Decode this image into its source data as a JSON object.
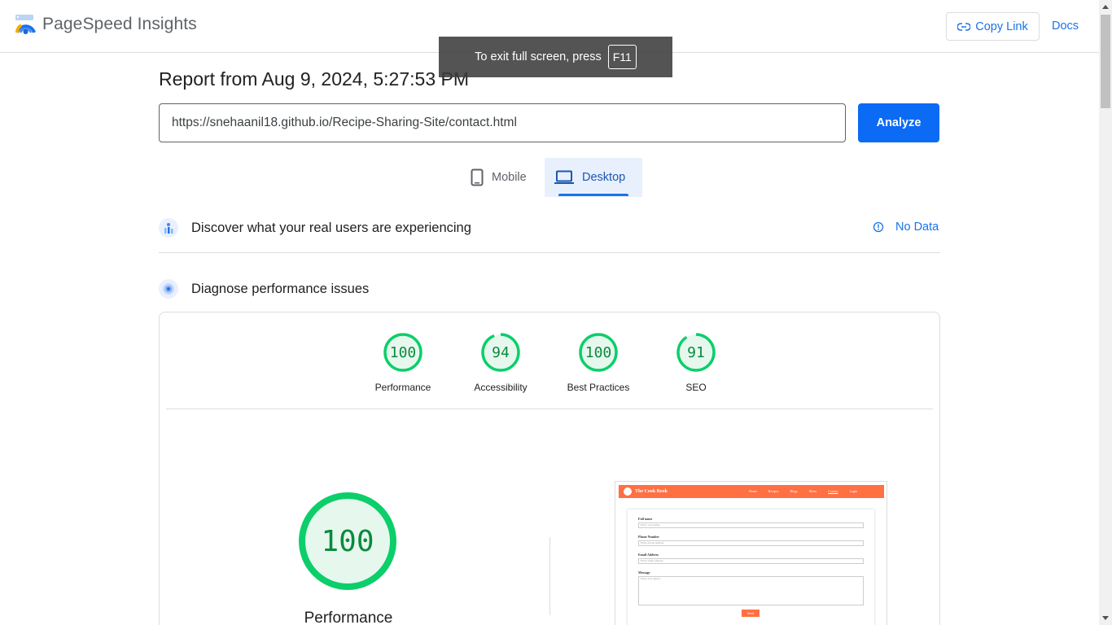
{
  "header": {
    "brand": "PageSpeed Insights",
    "copy_link": "Copy Link",
    "docs": "Docs"
  },
  "toast": {
    "text": "To exit full screen, press",
    "key": "F11"
  },
  "report": {
    "title": "Report from Aug 9, 2024, 5:27:53 PM",
    "url": "https://snehaanil18.github.io/Recipe-Sharing-Site/contact.html",
    "analyze_label": "Analyze"
  },
  "tabs": {
    "mobile": "Mobile",
    "desktop": "Desktop",
    "selected": "Desktop"
  },
  "sections": {
    "real_users": "Discover what your real users are experiencing",
    "no_data": "No Data",
    "diagnose": "Diagnose performance issues"
  },
  "scores": [
    {
      "label": "Performance",
      "value": "100",
      "fraction": 1.0
    },
    {
      "label": "Accessibility",
      "value": "94",
      "fraction": 0.94
    },
    {
      "label": "Best Practices",
      "value": "100",
      "fraction": 1.0
    },
    {
      "label": "SEO",
      "value": "91",
      "fraction": 0.91
    }
  ],
  "main_score": {
    "value": "100",
    "label": "Performance",
    "fraction": 1.0
  },
  "thumbnail": {
    "site_name": "The Cook Book",
    "nav": [
      "Home",
      "Recipes",
      "Blogs",
      "Menu",
      "Contact",
      "Login"
    ],
    "fields": [
      {
        "label": "Full name",
        "placeholder": "Enter your name"
      },
      {
        "label": "Phone Number",
        "placeholder": "Enter phone number"
      },
      {
        "label": "Email Address",
        "placeholder": "Enter email address"
      },
      {
        "label": "Message",
        "placeholder": "Enter your Query"
      }
    ],
    "send": "Send"
  },
  "colors": {
    "accent": "#1a73e8",
    "pass": "#0cce6b",
    "pass_text": "#0a8a3c",
    "pass_fill": "#e6f8ee",
    "thumb_brand": "#ff7043"
  }
}
